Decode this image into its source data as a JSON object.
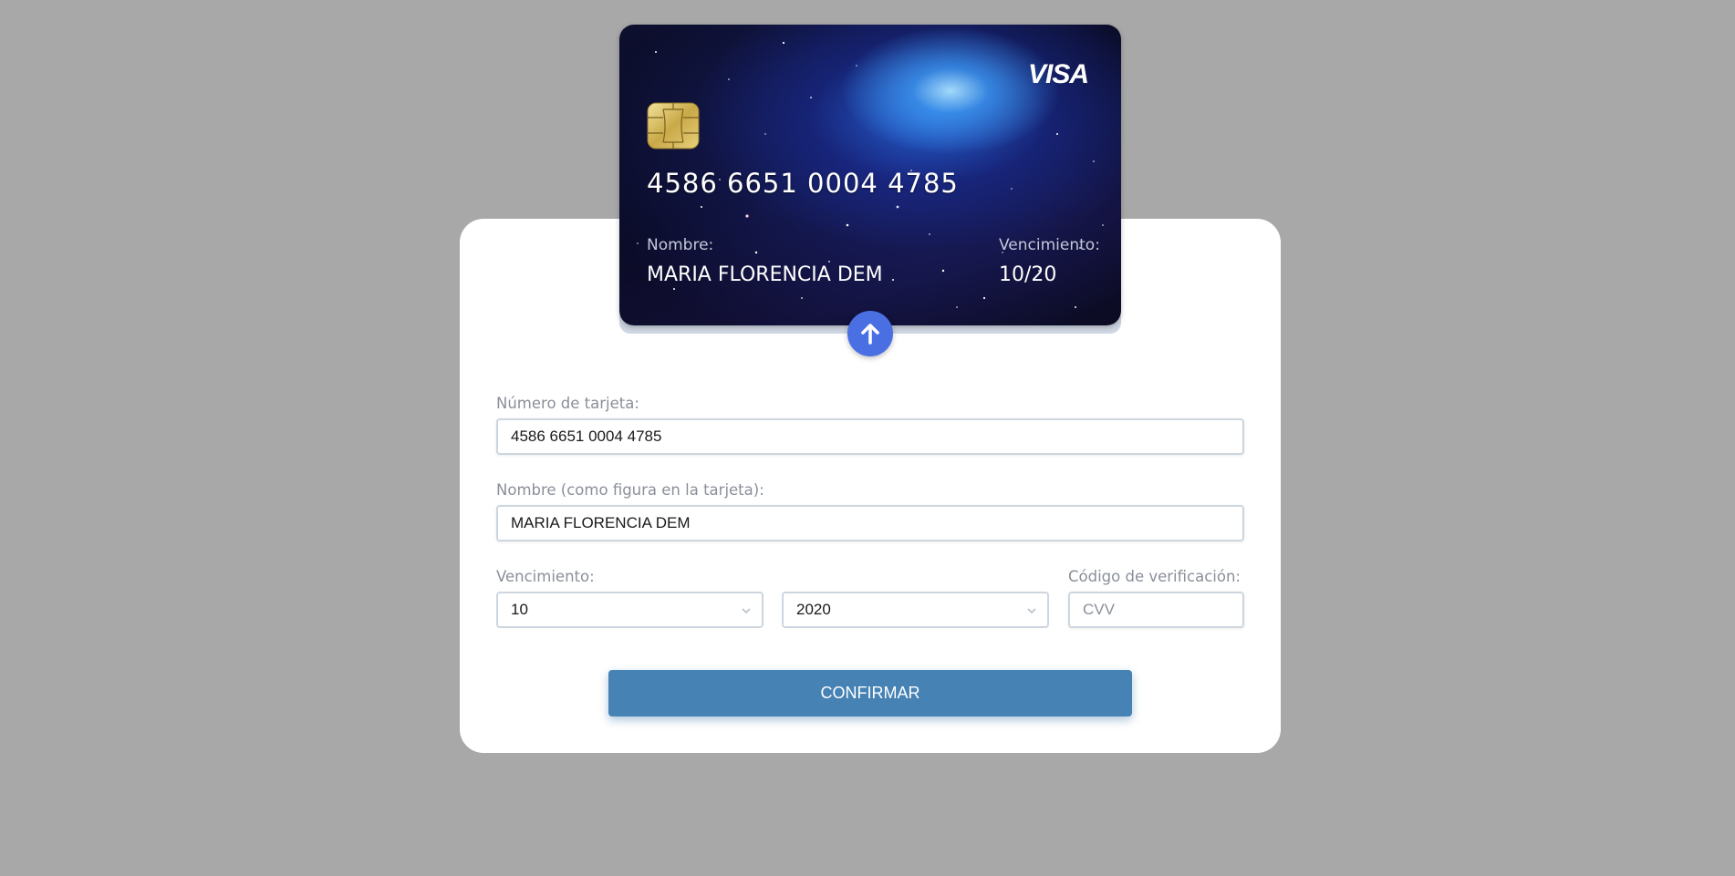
{
  "card": {
    "brand": "VISA",
    "number": "4586 6651 0004 4785",
    "name_label": "Nombre:",
    "name_value": "MARIA FLORENCIA DEM",
    "expiry_label": "Vencimiento:",
    "expiry_value": "10/20"
  },
  "form": {
    "number_label": "Número de tarjeta:",
    "number_value": "4586 6651 0004 4785",
    "name_label": "Nombre (como figura en la tarjeta):",
    "name_value": "MARIA FLORENCIA DEM",
    "expiry_label": "Vencimiento:",
    "expiry_month": "10",
    "expiry_year": "2020",
    "cvv_label": "Código de verificación:",
    "cvv_placeholder": "CVV",
    "confirm_label": "CONFIRMAR"
  },
  "colors": {
    "background": "#a8a8a8",
    "panel": "#ffffff",
    "flip_button": "#4a6fe3",
    "confirm_button": "#4682b4"
  },
  "icons": {
    "flip": "arrow-up-icon",
    "chip": "chip-icon",
    "select": "chevron-down-icon"
  }
}
